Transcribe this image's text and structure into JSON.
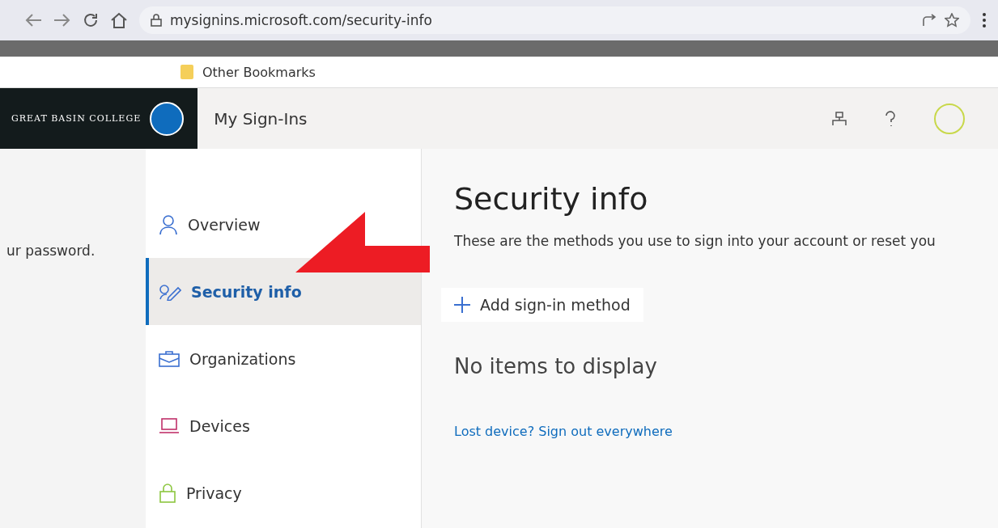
{
  "browser": {
    "url": "mysignins.microsoft.com/security-info",
    "bookmarks": [
      {
        "label": "Other Bookmarks"
      }
    ]
  },
  "header": {
    "title": "My Sign-Ins",
    "org": "GREAT BASIN COLLEGE"
  },
  "sidebar": {
    "items": [
      {
        "label": "Overview",
        "selected": false
      },
      {
        "label": "Security info",
        "selected": true
      },
      {
        "label": "Organizations",
        "selected": false
      },
      {
        "label": "Devices",
        "selected": false
      },
      {
        "label": "Privacy",
        "selected": false
      }
    ]
  },
  "main": {
    "title": "Security info",
    "description": "These are the methods you use to sign into your account or reset you",
    "description_fragment": "ur password.",
    "add_button": "Add sign-in method",
    "empty_text": "No items to display",
    "lost_device_link": "Lost device? Sign out everywhere"
  }
}
